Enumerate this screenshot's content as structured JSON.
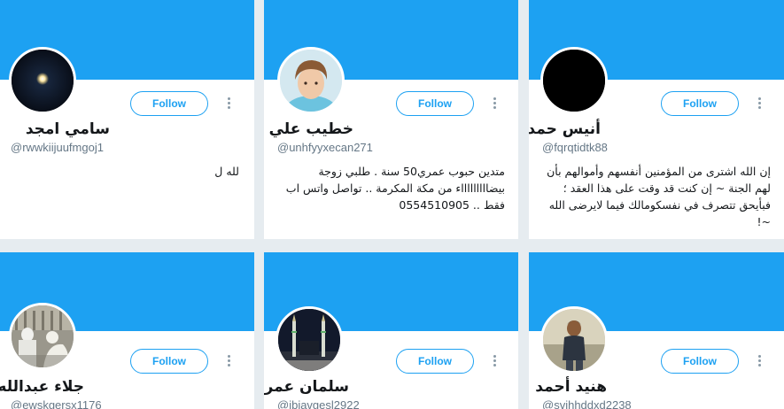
{
  "colors": {
    "banner": "#1da1f2",
    "accent": "#1da1f2",
    "background": "#e6ecf0"
  },
  "follow_label": "Follow",
  "cards": [
    {
      "name": "سامي امجد",
      "handle": "@rwwkiijuufmgoj1",
      "bio": "لله ل",
      "avatar_icon": "dark-orb-avatar"
    },
    {
      "name": "خطيب علي",
      "handle": "@unhfyyxecan271",
      "bio": "متدين حبوب عمري50 سنة . طلبي زوجة بيضاااااااااء من مكة المكرمة .. تواصل واتس اب فقط .. 0554510905",
      "avatar_icon": "boy-portrait-avatar"
    },
    {
      "name": "أنيس حمد",
      "handle": "@fqrqtidtk88",
      "bio": "إن الله اشترى من المؤمنين أنفسهم وأموالهم بأن لهم الجنة ~ إن كنت قد وقت على هذا العقد ؛ فبأيحق تتصرف في نفسكومالك فيما لايرضى الله ~!",
      "avatar_icon": "black-avatar"
    },
    {
      "name": "جلاء عبدالله",
      "handle": "@ewskgersx1176",
      "bio": "",
      "avatar_icon": "group-photo-avatar"
    },
    {
      "name": "سلمان عمر",
      "handle": "@ibjavgesl2922",
      "bio": "",
      "avatar_icon": "mosque-avatar"
    },
    {
      "name": "هنيد أحمد",
      "handle": "@svihhddxd2238",
      "bio": "",
      "avatar_icon": "man-outdoors-avatar"
    }
  ]
}
